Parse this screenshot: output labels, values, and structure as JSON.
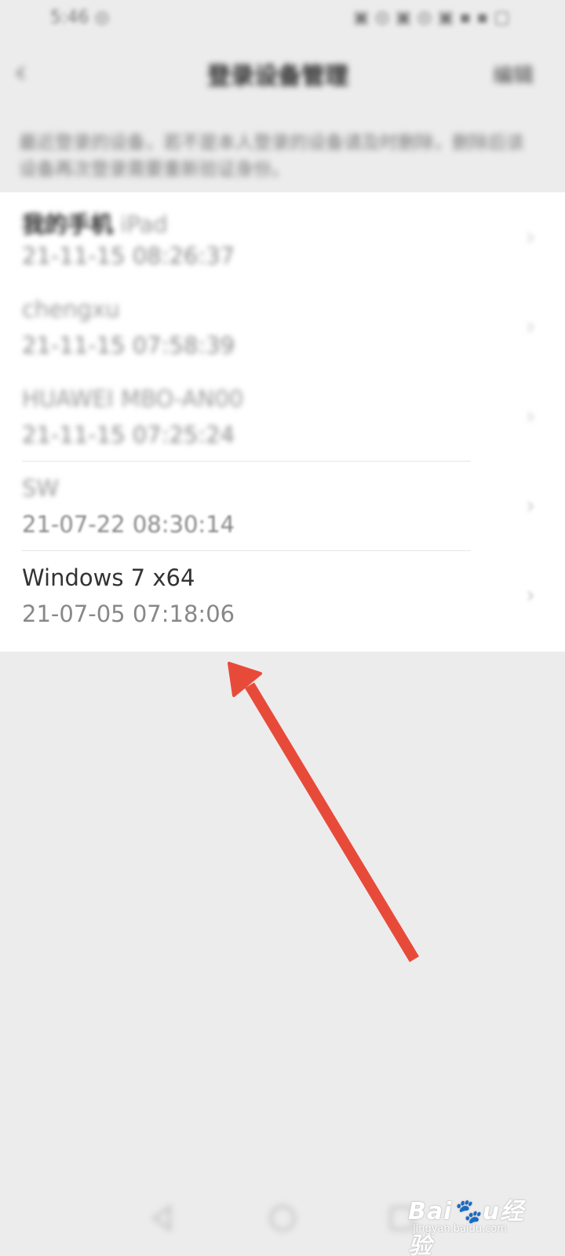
{
  "status_bar": {
    "left_text": "5:46 ◎",
    "right_text": "▣ ◎ ▣ ◎ ▣ ▪ ▪ ▢"
  },
  "header": {
    "back_icon": "chevron-left-icon",
    "title": "登录设备管理",
    "action_label": "编辑"
  },
  "description": "最近登录的设备，若不是本人登录的设备请及时删除，删除后该设备再次登录需要重新验证身份。",
  "devices": [
    {
      "name_bold": "我的手机",
      "name_light": " iPad",
      "time": "21-11-15 08:26:37"
    },
    {
      "name_bold": "",
      "name_light": "chengxu",
      "time": "21-11-15 07:58:39"
    },
    {
      "name_bold": "",
      "name_light": "HUAWEI MBO-AN00",
      "time": "21-11-15 07:25:24"
    },
    {
      "name_bold": "",
      "name_light": "SW",
      "time": "21-07-22 08:30:14"
    },
    {
      "name_bold": "",
      "name_light": "Windows 7 x64",
      "time": "21-07-05 07:18:06"
    }
  ],
  "annotation": {
    "color": "#e84a3a",
    "type": "arrow"
  },
  "nav": {
    "back_icon": "nav-back-icon",
    "home_icon": "nav-home-icon",
    "recent_icon": "nav-recent-icon"
  },
  "watermark": {
    "logo_text": "Bai🐾u经验",
    "sub_text": "jingyan.baidu.com"
  }
}
